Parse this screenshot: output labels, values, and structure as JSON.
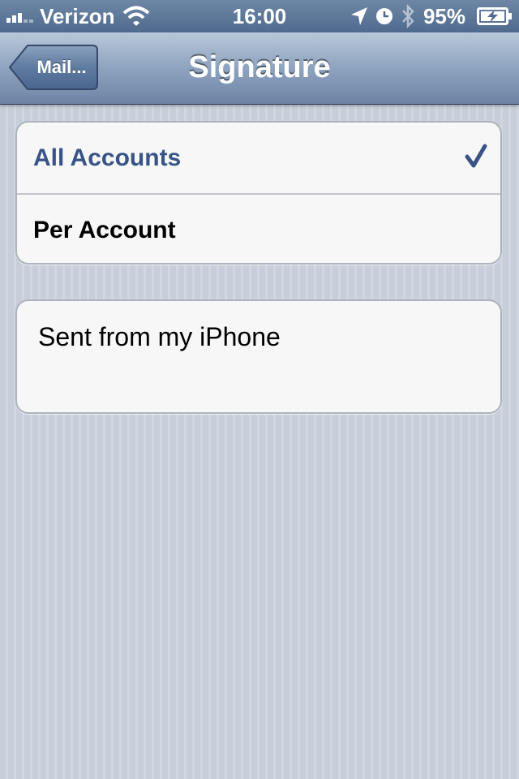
{
  "status_bar": {
    "carrier": "Verizon",
    "time": "16:00",
    "battery": "95%",
    "icons": [
      "signal-icon",
      "wifi-icon",
      "location-icon",
      "alarm-icon",
      "bluetooth-icon",
      "battery-charging-icon"
    ]
  },
  "nav": {
    "back_label": "Mail...",
    "title": "Signature"
  },
  "accounts": {
    "options": [
      {
        "label": "All Accounts",
        "selected": true
      },
      {
        "label": "Per Account",
        "selected": false
      }
    ]
  },
  "signature": {
    "text": "Sent from my iPhone"
  },
  "colors": {
    "selected_text": "#385487",
    "background": "#cbd2dc"
  }
}
